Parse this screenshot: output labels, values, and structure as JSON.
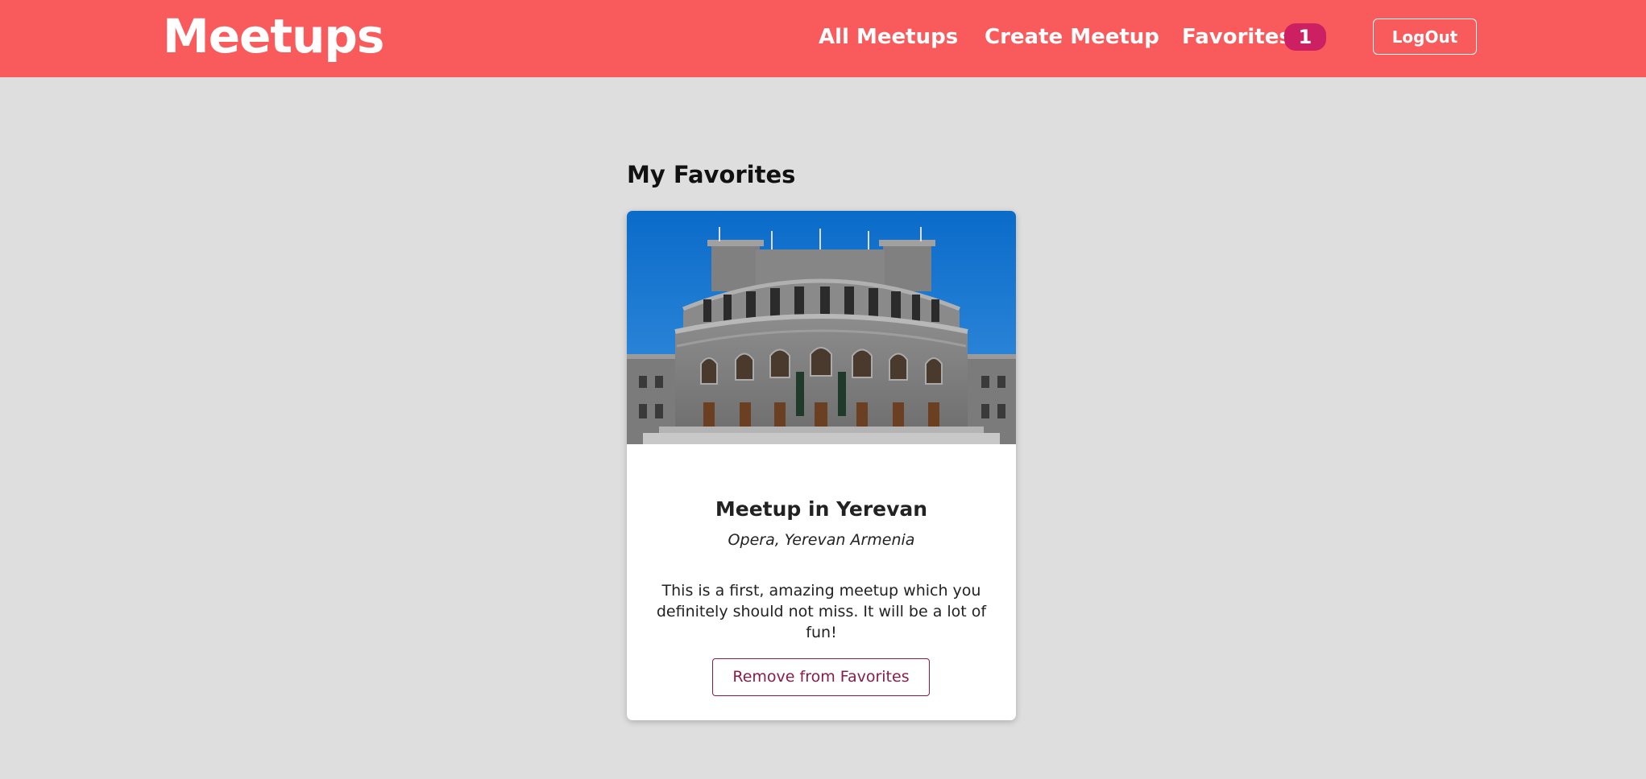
{
  "header": {
    "logo_text": "Meetups",
    "brand_color": "#f95a5c",
    "nav": {
      "all_meetups": "All Meetups",
      "create_meetup": "Create Meetup",
      "favorites": "Favorites",
      "favorites_count": "1"
    },
    "logout_label": "LogOut"
  },
  "main": {
    "page_title": "My Favorites",
    "favorites": [
      {
        "image_icon": "opera-building-photo",
        "title": "Meetup in Yerevan",
        "address": "Opera, Yerevan Armenia",
        "description": "This is a first, amazing meetup which you definitely should not miss. It will be a lot of fun!",
        "action_label": "Remove from Favorites"
      }
    ]
  },
  "colors": {
    "page_background": "#dedede",
    "badge": "#cc2062",
    "button_accent": "#8a1c4a"
  }
}
